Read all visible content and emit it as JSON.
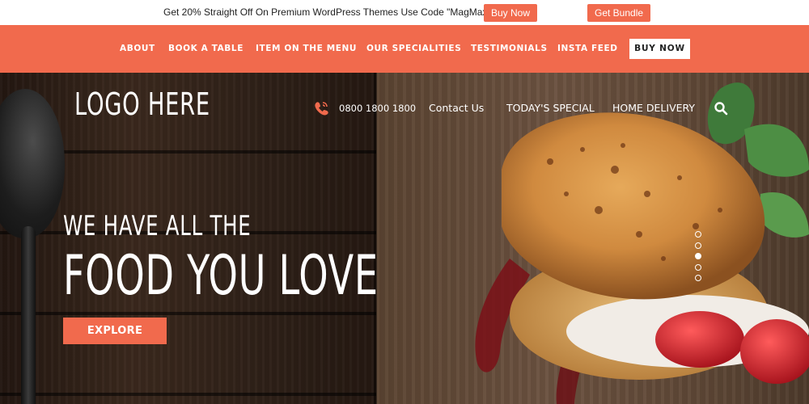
{
  "promo": {
    "text": "Get 20% Straight Off On Premium WordPress Themes Use Code \"MagMax20\" !!",
    "buy_label": "Buy Now",
    "bundle_label": "Get Bundle"
  },
  "nav": {
    "items": [
      "ABOUT",
      "BOOK A TABLE",
      "ITEM ON THE MENU",
      "OUR SPECIALITIES",
      "TESTIMONIALS",
      "INSTA FEED"
    ],
    "buy_label": "BUY NOW"
  },
  "header": {
    "logo": "LOGO HERE",
    "phone": "0800 1800 1800",
    "links": [
      "Contact Us",
      "TODAY'S SPECIAL",
      "HOME DELIVERY"
    ],
    "icons": {
      "phone": "phone-icon",
      "search": "search-icon"
    }
  },
  "hero": {
    "tagline_small": "WE HAVE ALL THE",
    "tagline_large": "FOOD YOU LOVE",
    "cta_label": "EXPLORE",
    "slides": {
      "count": 5,
      "active": 3
    }
  },
  "colors": {
    "accent": "#f16a4d",
    "text_light": "#ffffff",
    "text_dark": "#222222"
  }
}
